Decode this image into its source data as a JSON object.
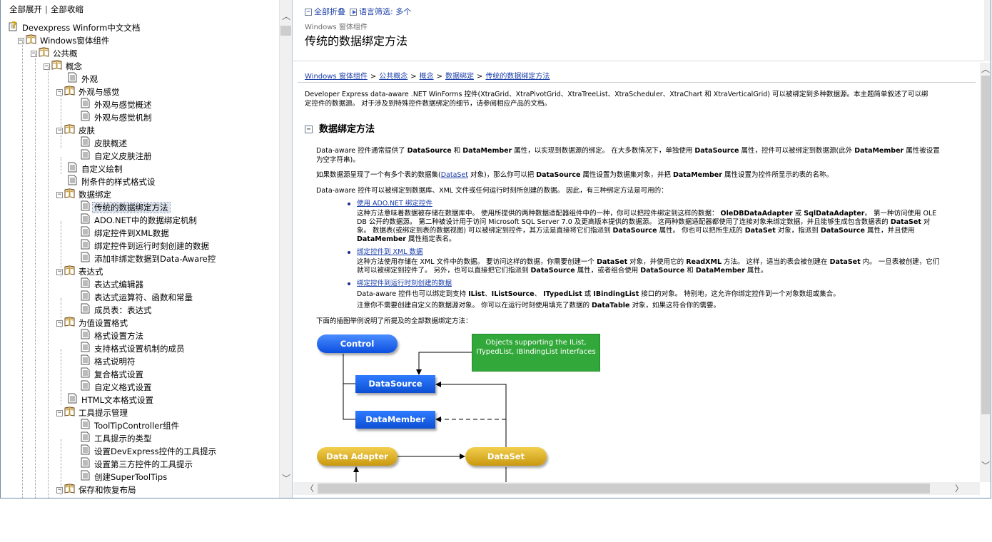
{
  "tree_header": {
    "expand_all": "全部展开",
    "separator": "|",
    "collapse_all": "全部收缩"
  },
  "tree": [
    {
      "label": "Devexpress Winform中文文档",
      "level": 0,
      "icon": "help-page-icon",
      "expander": ""
    },
    {
      "label": "Windows窗体组件",
      "level": 1,
      "icon": "book-icon",
      "expander": "−"
    },
    {
      "label": "公共概",
      "level": 2,
      "icon": "book-icon",
      "expander": "−"
    },
    {
      "label": "概念",
      "level": 3,
      "icon": "book-icon",
      "expander": "−"
    },
    {
      "label": "外观",
      "level": 4,
      "icon": "page-icon",
      "expander": ""
    },
    {
      "label": "外观与感觉",
      "level": 4,
      "icon": "book-icon",
      "expander": "−"
    },
    {
      "label": "外观与感觉概述",
      "level": 5,
      "icon": "page-icon",
      "expander": ""
    },
    {
      "label": "外观与感觉机制",
      "level": 5,
      "icon": "page-icon",
      "expander": ""
    },
    {
      "label": "皮肤",
      "level": 4,
      "icon": "book-icon",
      "expander": "−"
    },
    {
      "label": "皮肤概述",
      "level": 5,
      "icon": "page-icon",
      "expander": ""
    },
    {
      "label": "自定义皮肤注册",
      "level": 5,
      "icon": "page-icon",
      "expander": ""
    },
    {
      "label": "自定义绘制",
      "level": 4,
      "icon": "page-icon",
      "expander": ""
    },
    {
      "label": "附条件的样式格式设",
      "level": 4,
      "icon": "page-icon",
      "expander": ""
    },
    {
      "label": "数据绑定",
      "level": 4,
      "icon": "book-icon",
      "expander": "−"
    },
    {
      "label": "传统的数据绑定方法",
      "level": 5,
      "icon": "page-icon",
      "expander": "",
      "selected": true
    },
    {
      "label": "ADO.NET中的数据绑定机制",
      "level": 5,
      "icon": "page-icon",
      "expander": ""
    },
    {
      "label": "绑定控件到XML数据",
      "level": 5,
      "icon": "page-icon",
      "expander": ""
    },
    {
      "label": "绑定控件到运行时刻创建的数据",
      "level": 5,
      "icon": "page-icon",
      "expander": ""
    },
    {
      "label": "添加非绑定数据到Data-Aware控",
      "level": 5,
      "icon": "page-icon",
      "expander": ""
    },
    {
      "label": "表达式",
      "level": 4,
      "icon": "book-icon",
      "expander": "−"
    },
    {
      "label": "表达式编辑器",
      "level": 5,
      "icon": "page-icon",
      "expander": ""
    },
    {
      "label": "表达式运算符、函数和常量",
      "level": 5,
      "icon": "page-icon",
      "expander": ""
    },
    {
      "label": "成员表：表达式",
      "level": 5,
      "icon": "page-icon",
      "expander": ""
    },
    {
      "label": "为值设置格式",
      "level": 4,
      "icon": "book-icon",
      "expander": "−"
    },
    {
      "label": "格式设置方法",
      "level": 5,
      "icon": "page-icon",
      "expander": ""
    },
    {
      "label": "支持格式设置机制的成员",
      "level": 5,
      "icon": "page-icon",
      "expander": ""
    },
    {
      "label": "格式说明符",
      "level": 5,
      "icon": "page-icon",
      "expander": ""
    },
    {
      "label": "复合格式设置",
      "level": 5,
      "icon": "page-icon",
      "expander": ""
    },
    {
      "label": "自定义格式设置",
      "level": 5,
      "icon": "page-icon",
      "expander": ""
    },
    {
      "label": "HTML文本格式设置",
      "level": 4,
      "icon": "page-icon",
      "expander": ""
    },
    {
      "label": "工具提示管理",
      "level": 4,
      "icon": "book-icon",
      "expander": "−"
    },
    {
      "label": "ToolTipController组件",
      "level": 5,
      "icon": "page-icon",
      "expander": ""
    },
    {
      "label": "工具提示的类型",
      "level": 5,
      "icon": "page-icon",
      "expander": ""
    },
    {
      "label": "设置DevExpress控件的工具提示",
      "level": 5,
      "icon": "page-icon",
      "expander": ""
    },
    {
      "label": "设置第三方控件的工具提示",
      "level": 5,
      "icon": "page-icon",
      "expander": ""
    },
    {
      "label": "创建SuperToolTips",
      "level": 5,
      "icon": "page-icon",
      "expander": ""
    },
    {
      "label": "保存和恢复布局",
      "level": 4,
      "icon": "book-icon",
      "expander": "−"
    }
  ],
  "header": {
    "collapse_all": "全部折叠",
    "language_filter": "语言筛选:",
    "language_value": "多个",
    "section_small": "Windows 窗体组件",
    "title": "传统的数据绑定方法"
  },
  "breadcrumb": {
    "items": [
      "Windows 窗体组件",
      "公共概念",
      "概念",
      "数据绑定",
      "传统的数据绑定方法"
    ],
    "separator": ">"
  },
  "intro": {
    "line1": "Developer Express data-aware .NET WinForms 控件(XtraGrid、XtraPivotGrid、XtraTreeList、XtraScheduler、XtraChart 和 XtraVerticalGrid) 可以被绑定到多种数据源。本主题简单叙述了可以绑",
    "line2": "定控件的数据源。 对于涉及到特殊控件数据绑定的细节，请参阅相应产品的文档。"
  },
  "section": {
    "toggle": "−",
    "heading": "数据绑定方法"
  },
  "para1": {
    "l1_a": "Data-aware 控件通常提供了 ",
    "l1_b": "DataSource",
    "l1_c": " 和 ",
    "l1_d": "DataMember",
    "l1_e": " 属性，以实现到数据源的绑定。 在大多数情况下，单独使用 ",
    "l1_f": "DataSource",
    "l1_g": " 属性，控件可以被绑定到数据源(此外 ",
    "l1_h": "DataMember",
    "l1_i": " 属性被设置",
    "l2": "为空字符串)。"
  },
  "para2": {
    "a": "如果数据源呈现了一个有多个表的数据集(",
    "link": "DataSet",
    "b": " 对象)，那么你可以把 ",
    "c": "DataSource",
    "d": " 属性设置为数据集对象，并把 ",
    "e": "DataMember",
    "f": " 属性设置为控件所显示的表的名称。"
  },
  "para3": "Data-aware 控件可以被绑定到数据库、XML 文件或任何运行时刻所创建的数据。 因此，有三种绑定方法是可用的：",
  "bullets": {
    "b1_link": "使用 ADO.NET 绑定控件",
    "b1_l1_a": "这种方法意味着数据被存储在数据库中。 使用所提供的两种数据适配器组件中的一种，你可以把控件绑定到这样的数据： ",
    "b1_l1_b": "OleDBDataAdapter",
    "b1_l1_c": " 或 ",
    "b1_l1_d": "SqlDataAdapter",
    "b1_l1_e": "。 第一种访问使用 OLE",
    "b1_l2_a": "DB 公开的数据源。 第二种被设计用于访问 Microsoft SQL Server 7.0 及更高版本提供的数据源。 这两种数据适配器都使用了连接对象来绑定数据，并且能够生成包含数据表的 ",
    "b1_l2_b": "DataSet",
    "b1_l2_c": " 对",
    "b1_l3_a": "象。 数据表(或绑定到表的数据视图) 可以被绑定到控件，其方法是直接将它们指派到 ",
    "b1_l3_b": "DataSource",
    "b1_l3_c": " 属性。 你也可以把所生成的 ",
    "b1_l3_d": "DataSet",
    "b1_l3_e": " 对象，指派到 ",
    "b1_l3_f": "DataSource",
    "b1_l3_g": " 属性，并且使用",
    "b1_l4_a": "DataMember",
    "b1_l4_b": " 属性指定表名。",
    "b2_link": "绑定控件到 XML 数据",
    "b2_l1_a": "这种方法使用存储在 XML 文件中的数据。 要访问这样的数据，你需要创建一个 ",
    "b2_l1_b": "DataSet",
    "b2_l1_c": " 对象，并使用它的 ",
    "b2_l1_d": "ReadXML",
    "b2_l1_e": " 方法。 这样，适当的表会被创建在 ",
    "b2_l1_f": "DataSet",
    "b2_l1_g": " 内。 一旦表被创建，它们",
    "b2_l2_a": "就可以被绑定到控件了。 另外，也可以直接把它们指派到 ",
    "b2_l2_b": "DataSource",
    "b2_l2_c": " 属性，或者组合使用 ",
    "b2_l2_d": "DataSource",
    "b2_l2_e": " 和 ",
    "b2_l2_f": "DataMember",
    "b2_l2_g": " 属性。",
    "b3_link": "绑定控件到运行时刻创建的数据",
    "b3_l1_a": "Data-aware 控件也可以绑定到支持 ",
    "b3_l1_b": "IList",
    "b3_l1_c": "、",
    "b3_l1_d": "IListSource",
    "b3_l1_e": "、 ",
    "b3_l1_f": "ITypedList",
    "b3_l1_g": " 或 ",
    "b3_l1_h": "IBindingList",
    "b3_l1_i": " 接口的对象。 特别地，这允许你绑定控件到一个对象数组或集合。",
    "b3_l2_a": "注意你不需要创建自定义的数据源对象。 你可以在运行时刻使用填充了数据的 ",
    "b3_l2_b": "DataTable",
    "b3_l2_c": " 对象，如果这符合你的需要。"
  },
  "para4": "下面的插图举例说明了所提及的全部数据绑定方法：",
  "diagram": {
    "control": "Control",
    "objects_note": "Objects supporting the IList, ITypedList, IBindingList interfaces",
    "datasource": "DataSource",
    "datamember": "DataMember",
    "data_adapter": "Data Adapter",
    "dataset": "DataSet"
  },
  "colors": {
    "link": "#1a3da8",
    "blue_node": "#0b4fe0",
    "gold_node": "#d9ac21",
    "green_note": "#32a83a"
  }
}
